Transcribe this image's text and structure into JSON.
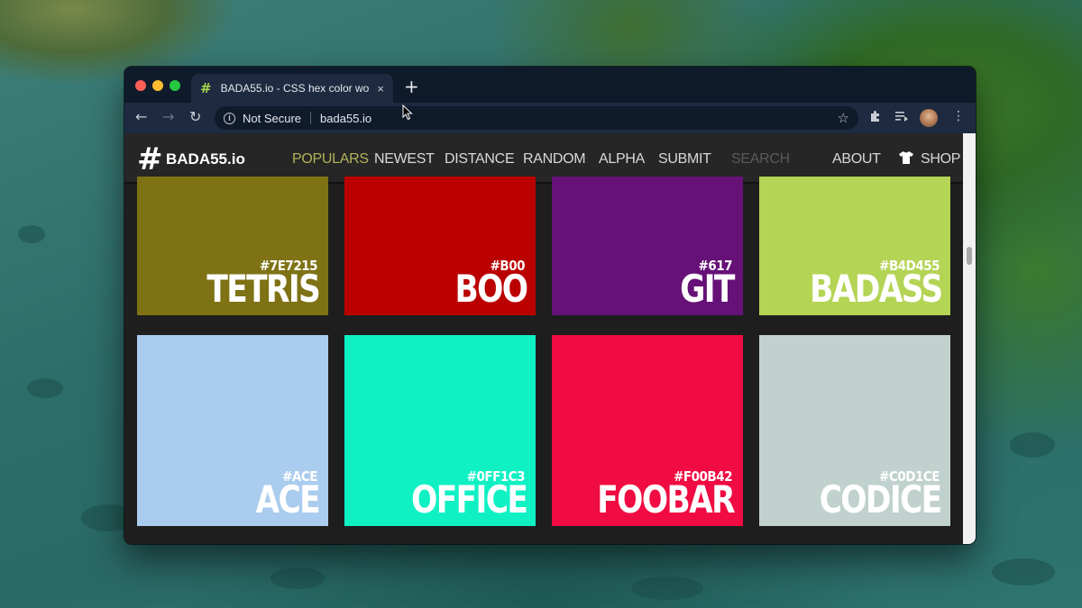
{
  "browser": {
    "tab_title": "BADA55.io - CSS hex color wo",
    "tab_favicon": "#",
    "tab_close": "×",
    "new_tab": "+",
    "back": "←",
    "forward": "→",
    "reload": "↻",
    "security_label": "Not Secure",
    "url": "bada55.io",
    "bookmark_star": "☆",
    "extensions_icon": "puzzle-icon",
    "media_icon": "media-queue-icon",
    "menu": "⋮"
  },
  "site": {
    "logo_hash": "#",
    "logo_text": "BADA55.io",
    "nav": {
      "populars": "POPULARS",
      "newest": "NEWEST",
      "distance": "DISTANCE",
      "random": "RANDOM",
      "alpha": "ALPHA",
      "submit": "SUBMIT",
      "search": "SEARCH",
      "about": "ABOUT",
      "shop": "SHOP"
    },
    "colors": [
      {
        "hex": "#7E7215",
        "name": "TETRIS",
        "color": "#7E7215"
      },
      {
        "hex": "#B00",
        "name": "BOO",
        "color": "#BB0000"
      },
      {
        "hex": "#617",
        "name": "GIT",
        "color": "#661177"
      },
      {
        "hex": "#B4D455",
        "name": "BADASS",
        "color": "#B4D455"
      },
      {
        "hex": "#ACE",
        "name": "ACE",
        "color": "#AACCEE"
      },
      {
        "hex": "#0FF1C3",
        "name": "OFFICE",
        "color": "#0FF1C3"
      },
      {
        "hex": "#F00B42",
        "name": "FOOBAR",
        "color": "#F00B42"
      },
      {
        "hex": "#C0D1CE",
        "name": "CODICE",
        "color": "#C0D1CE"
      }
    ]
  }
}
